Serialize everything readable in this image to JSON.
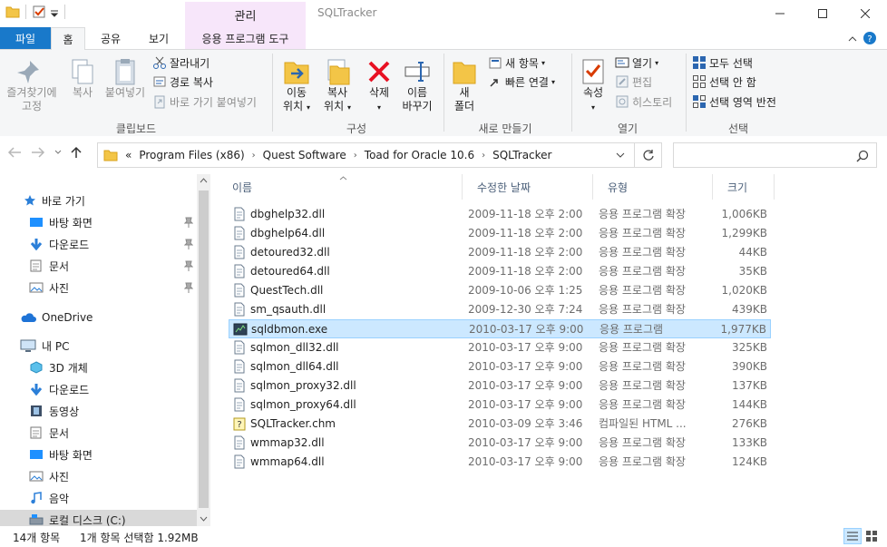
{
  "window": {
    "title": "SQLTracker",
    "context_label": "관리"
  },
  "tabs": {
    "file": "파일",
    "home": "홈",
    "share": "공유",
    "view": "보기",
    "tools": "응용 프로그램 도구"
  },
  "ribbon": {
    "clipboard": {
      "pin_quick_line1": "즐겨찾기에",
      "pin_quick_line2": "고정",
      "copy": "복사",
      "paste": "붙여넣기",
      "cut": "잘라내기",
      "copy_path": "경로 복사",
      "paste_shortcut": "바로 가기 붙여넣기",
      "label": "클립보드"
    },
    "organize": {
      "move_line1": "이동",
      "move_line2": "위치",
      "copyto_line1": "복사",
      "copyto_line2": "위치",
      "delete": "삭제",
      "rename_line1": "이름",
      "rename_line2": "바꾸기",
      "label": "구성"
    },
    "new": {
      "new_folder_line1": "새",
      "new_folder_line2": "폴더",
      "new_item": "새 항목",
      "easy_access": "빠른 연결",
      "label": "새로 만들기"
    },
    "open": {
      "properties": "속성",
      "open": "열기",
      "edit": "편집",
      "history": "히스토리",
      "label": "열기"
    },
    "select": {
      "select_all": "모두 선택",
      "select_none": "선택 안 함",
      "invert": "선택 영역 반전",
      "label": "선택"
    }
  },
  "address": {
    "overflow": "«",
    "crumbs": [
      "Program Files (x86)",
      "Quest Software",
      "Toad for Oracle 10.6",
      "SQLTracker"
    ]
  },
  "nav": {
    "quick_access": "바로 가기",
    "qa_items": [
      "바탕 화면",
      "다운로드",
      "문서",
      "사진"
    ],
    "onedrive": "OneDrive",
    "this_pc": "내 PC",
    "pc_items": [
      "3D 개체",
      "다운로드",
      "동영상",
      "문서",
      "바탕 화면",
      "사진",
      "음악",
      "로컬 디스크 (C:)"
    ]
  },
  "columns": {
    "name": "이름",
    "date": "수정한 날짜",
    "type": "유형",
    "size": "크기"
  },
  "files": [
    {
      "name": "dbghelp32.dll",
      "date": "2009-11-18 오후 2:00",
      "type": "응용 프로그램 확장",
      "size": "1,006KB",
      "icon": "dll"
    },
    {
      "name": "dbghelp64.dll",
      "date": "2009-11-18 오후 2:00",
      "type": "응용 프로그램 확장",
      "size": "1,299KB",
      "icon": "dll"
    },
    {
      "name": "detoured32.dll",
      "date": "2009-11-18 오후 2:00",
      "type": "응용 프로그램 확장",
      "size": "44KB",
      "icon": "dll"
    },
    {
      "name": "detoured64.dll",
      "date": "2009-11-18 오후 2:00",
      "type": "응용 프로그램 확장",
      "size": "35KB",
      "icon": "dll"
    },
    {
      "name": "QuestTech.dll",
      "date": "2009-10-06 오후 1:25",
      "type": "응용 프로그램 확장",
      "size": "1,020KB",
      "icon": "dll"
    },
    {
      "name": "sm_qsauth.dll",
      "date": "2009-12-30 오후 7:24",
      "type": "응용 프로그램 확장",
      "size": "439KB",
      "icon": "dll"
    },
    {
      "name": "sqldbmon.exe",
      "date": "2010-03-17 오후 9:00",
      "type": "응용 프로그램",
      "size": "1,977KB",
      "icon": "exe"
    },
    {
      "name": "sqlmon_dll32.dll",
      "date": "2010-03-17 오후 9:00",
      "type": "응용 프로그램 확장",
      "size": "325KB",
      "icon": "dll"
    },
    {
      "name": "sqlmon_dll64.dll",
      "date": "2010-03-17 오후 9:00",
      "type": "응용 프로그램 확장",
      "size": "390KB",
      "icon": "dll"
    },
    {
      "name": "sqlmon_proxy32.dll",
      "date": "2010-03-17 오후 9:00",
      "type": "응용 프로그램 확장",
      "size": "137KB",
      "icon": "dll"
    },
    {
      "name": "sqlmon_proxy64.dll",
      "date": "2010-03-17 오후 9:00",
      "type": "응용 프로그램 확장",
      "size": "144KB",
      "icon": "dll"
    },
    {
      "name": "SQLTracker.chm",
      "date": "2010-03-09 오후 3:46",
      "type": "컴파일된 HTML ...",
      "size": "276KB",
      "icon": "chm"
    },
    {
      "name": "wmmap32.dll",
      "date": "2010-03-17 오후 9:00",
      "type": "응용 프로그램 확장",
      "size": "133KB",
      "icon": "dll"
    },
    {
      "name": "wmmap64.dll",
      "date": "2010-03-17 오후 9:00",
      "type": "응용 프로그램 확장",
      "size": "124KB",
      "icon": "dll"
    }
  ],
  "selected_index": 6,
  "status": {
    "count": "14개 항목",
    "selection": "1개 항목 선택함 1.92MB"
  },
  "colors": {
    "file_tab": "#1979ca",
    "context_tab": "#f7e6fa",
    "selection_bg": "#cce8ff",
    "selection_border": "#99d1ff"
  }
}
